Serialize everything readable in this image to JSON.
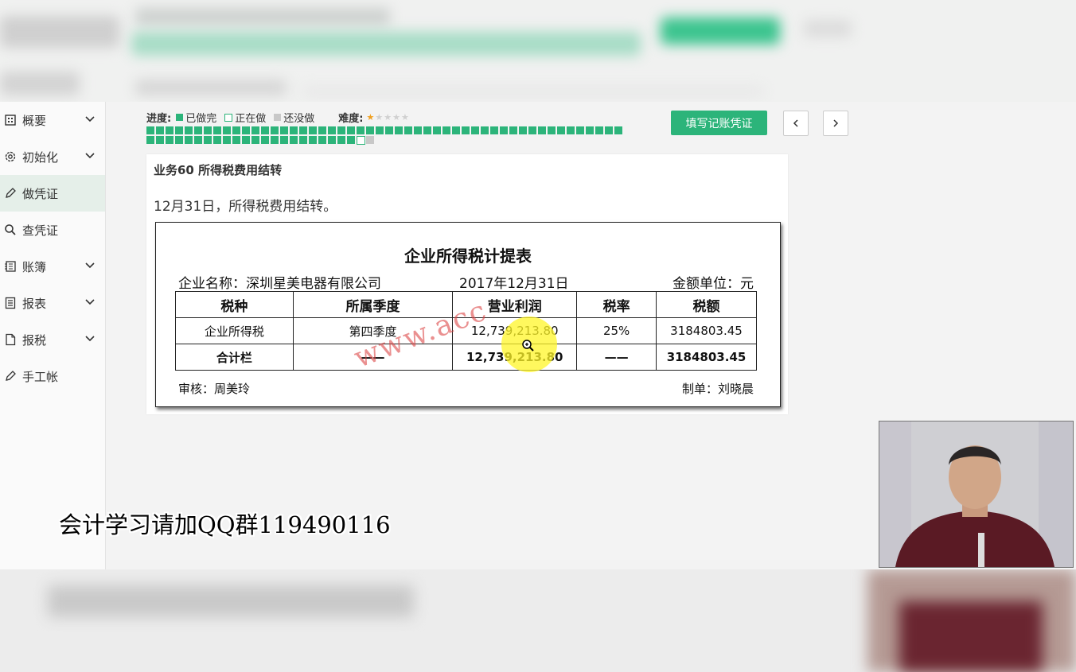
{
  "sidebar": {
    "items": [
      {
        "label": "概要",
        "icon": "grid-icon",
        "has_chevron": true
      },
      {
        "label": "初始化",
        "icon": "gear-icon",
        "has_chevron": true
      },
      {
        "label": "做凭证",
        "icon": "pen-icon",
        "has_chevron": false,
        "active": true
      },
      {
        "label": "查凭证",
        "icon": "search-icon",
        "has_chevron": false
      },
      {
        "label": "账簿",
        "icon": "ledger-icon",
        "has_chevron": true
      },
      {
        "label": "报表",
        "icon": "report-icon",
        "has_chevron": true
      },
      {
        "label": "报税",
        "icon": "document-icon",
        "has_chevron": true
      },
      {
        "label": "手工帐",
        "icon": "pen-icon",
        "has_chevron": false
      }
    ]
  },
  "progress": {
    "label": "进度:",
    "done_label": "已做完",
    "doing_label": "正在做",
    "todo_label": "还没做",
    "difficulty_label": "难度:",
    "difficulty_stars": 1,
    "difficulty_max": 5,
    "done_count": 72,
    "doing_count": 1,
    "todo_count": 1,
    "colors": {
      "done": "#2cb47a",
      "doing": "#ffffff",
      "todo": "#c8c8c8"
    }
  },
  "actions": {
    "fill_voucher": "填写记账凭证",
    "prev_icon": "chevron-left-icon",
    "next_icon": "chevron-right-icon"
  },
  "task": {
    "title": "业务60 所得税费用结转",
    "description": "12月31日，所得税费用结转。"
  },
  "sheet": {
    "title": "企业所得税计提表",
    "company": "企业名称：深圳星美电器有限公司",
    "date": "2017年12月31日",
    "unit": "金额单位：元",
    "headers": [
      "税种",
      "所属季度",
      "营业利润",
      "税率",
      "税额"
    ],
    "rows": [
      [
        "企业所得税",
        "第四季度",
        "12,739,213.80",
        "25%",
        "3184803.45"
      ]
    ],
    "total": [
      "合计栏",
      "——",
      "12,739,213.80",
      "——",
      "3184803.45"
    ],
    "reviewer": "审核：周美玲",
    "preparer": "制单：刘晓晨",
    "watermark": "www.acc"
  },
  "caption": "会计学习请加QQ群119490116",
  "accent": "#2cb47a"
}
